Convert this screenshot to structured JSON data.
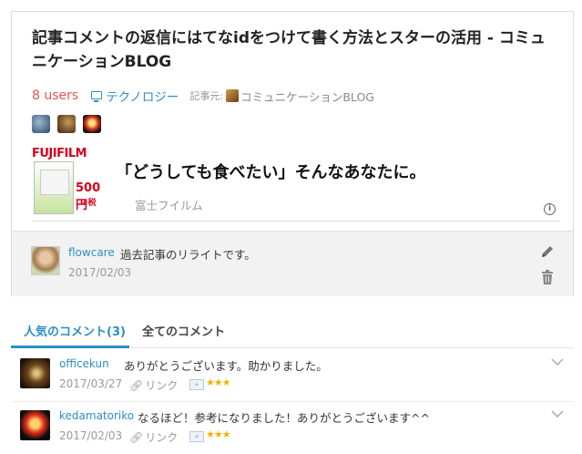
{
  "entry": {
    "title": "記事コメントの返信にはてなidをつけて書く方法とスターの活用 - コミュニケーションBLOG",
    "users": "8 users",
    "category": "テクノロジー",
    "source_label": "記事元:",
    "source_name": "コミュニケーションBLOG"
  },
  "ad": {
    "brand": "FUJIFILM",
    "price": "500円",
    "tax": "+税",
    "headline": "「どうしても食べたい」そんなあなたに。",
    "sponsor": "富士フイルム",
    "info_icon": "i"
  },
  "my_bookmark": {
    "user": "flowcare",
    "comment": "過去記事のリライトです。",
    "date": "2017/02/03"
  },
  "tabs": {
    "popular": "人気のコメント(3)",
    "all": "全てのコメント"
  },
  "comments": [
    {
      "user": "officekun",
      "text": "ありがとうございます。助かりました。",
      "date": "2017/03/27",
      "link": "リンク",
      "stars": "★★★"
    },
    {
      "user": "kedamatoriko",
      "text": "なるほど！参考になりました！ありがとうございます^^",
      "date": "2017/02/03",
      "link": "リンク",
      "stars": "★★★"
    }
  ],
  "colors": {
    "accent": "#2b8fc4",
    "users": "#e35454",
    "star": "#f5b300"
  }
}
